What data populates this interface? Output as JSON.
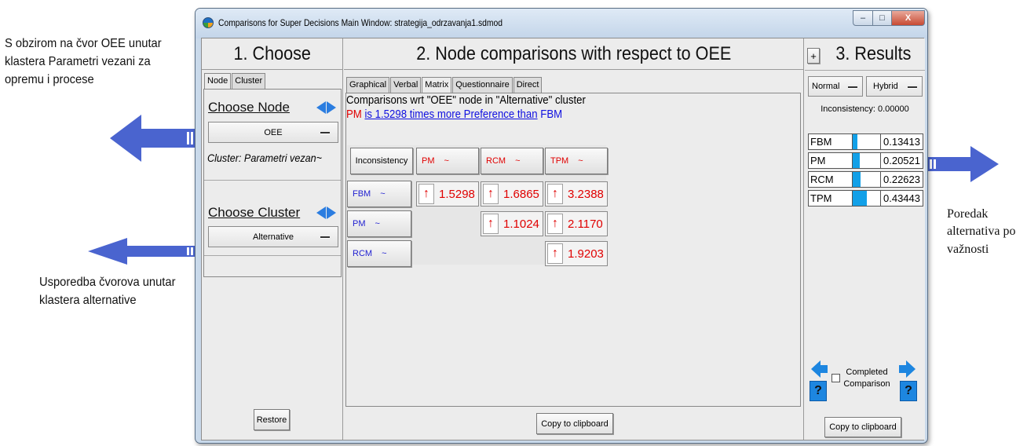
{
  "annotations": {
    "top_left": "S obzirom na čvor OEE unutar klastera Parametri vezani za opremu i procese",
    "bottom_left": "Usporedba čvorova unutar klastera alternative",
    "right": "Poredak alternativa po važnosti"
  },
  "window": {
    "title": "Comparisons for Super Decisions Main Window: strategija_odrzavanja1.sdmod",
    "min_label": "–",
    "max_label": "□",
    "close_label": "X"
  },
  "choose": {
    "header": "1. Choose",
    "tabs": [
      "Node",
      "Cluster"
    ],
    "choose_node_label": "Choose Node",
    "node_value": "OEE",
    "cluster_info": "Cluster: Parametri vezan~",
    "choose_cluster_label": "Choose Cluster",
    "cluster_value": "Alternative",
    "restore_label": "Restore"
  },
  "compare": {
    "header": "2. Node comparisons with respect to OEE",
    "tabs": [
      "Graphical",
      "Verbal",
      "Matrix",
      "Questionnaire",
      "Direct"
    ],
    "title": "Comparisons wrt \"OEE\" node in \"Alternative\" cluster",
    "sentence": {
      "left": "PM",
      "middle": "is 1.5298 times more Preference than",
      "right": "FBM"
    },
    "inconsistency_label": "Inconsistency",
    "tilde": "~",
    "columns": [
      "PM",
      "RCM",
      "TPM"
    ],
    "rows": [
      "FBM",
      "PM",
      "RCM"
    ],
    "cells": [
      {
        "row": "FBM",
        "col": "PM",
        "value": "1.5298"
      },
      {
        "row": "FBM",
        "col": "RCM",
        "value": "1.6865"
      },
      {
        "row": "FBM",
        "col": "TPM",
        "value": "3.2388"
      },
      {
        "row": "PM",
        "col": "RCM",
        "value": "1.1024"
      },
      {
        "row": "PM",
        "col": "TPM",
        "value": "2.1170"
      },
      {
        "row": "RCM",
        "col": "TPM",
        "value": "1.9203"
      }
    ],
    "copy_label": "Copy to clipboard"
  },
  "results": {
    "plus_label": "+",
    "header": "3. Results",
    "mode_normal": "Normal",
    "mode_hybrid": "Hybrid",
    "inconsistency": "Inconsistency: 0.00000",
    "priorities": [
      {
        "name": "FBM",
        "value": "0.13413",
        "level": 0.13413
      },
      {
        "name": "PM",
        "value": "0.20521",
        "level": 0.20521
      },
      {
        "name": "RCM",
        "value": "0.22623",
        "level": 0.22623
      },
      {
        "name": "TPM",
        "value": "0.43443",
        "level": 0.43443
      }
    ],
    "completed_label": "Completed Comparison",
    "help_glyph": "?",
    "copy_label": "Copy to clipboard"
  },
  "colors": {
    "arrow_blue": "#3f5fcf",
    "preference_red": "#e00000",
    "row_blue": "#2020d0",
    "bar_blue": "#12a0e8"
  }
}
